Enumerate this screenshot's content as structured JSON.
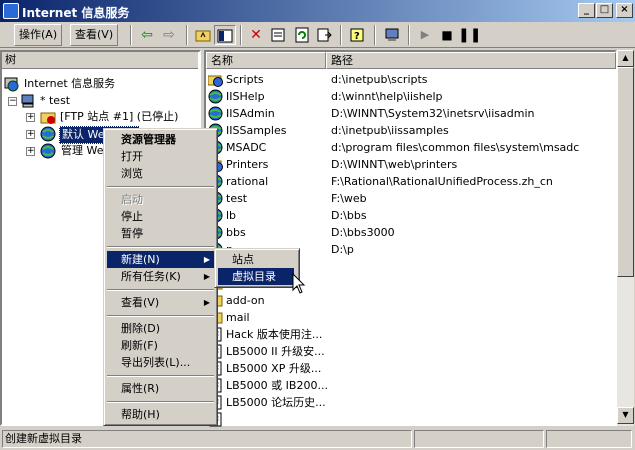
{
  "window": {
    "title": "Internet 信息服务"
  },
  "menubar": {
    "action": "操作(A)",
    "view": "查看(V)"
  },
  "tree": {
    "header": "树",
    "root": "Internet 信息服务",
    "server": "* test",
    "ftp": "[FTP 站点 #1] (已停止)",
    "default_web": "默认 Web 站点",
    "admin_web": "管理 Web 站点"
  },
  "list": {
    "col_name": "名称",
    "col_path": "路径",
    "rows": [
      {
        "name": "Scripts",
        "path": "d:\\inetpub\\scripts",
        "icon": "globe-folder-icon"
      },
      {
        "name": "IISHelp",
        "path": "d:\\winnt\\help\\iishelp",
        "icon": "globe-icon"
      },
      {
        "name": "IISAdmin",
        "path": "D:\\WINNT\\System32\\inetsrv\\iisadmin",
        "icon": "globe-icon"
      },
      {
        "name": "IISSamples",
        "path": "d:\\inetpub\\iissamples",
        "icon": "globe-icon"
      },
      {
        "name": "MSADC",
        "path": "d:\\program files\\common files\\system\\msadc",
        "icon": "globe-icon"
      },
      {
        "name": "Printers",
        "path": "D:\\WINNT\\web\\printers",
        "icon": "globe-folder-icon"
      },
      {
        "name": "rational",
        "path": "F:\\Rational\\RationalUnifiedProcess.zh_cn",
        "icon": "globe-icon"
      },
      {
        "name": "test",
        "path": "F:\\web",
        "icon": "globe-icon"
      },
      {
        "name": "lb",
        "path": "D:\\bbs",
        "icon": "globe-icon"
      },
      {
        "name": "bbs",
        "path": "D:\\bbs3000",
        "icon": "globe-icon"
      },
      {
        "name": "p",
        "path": "D:\\p",
        "icon": "globe-icon"
      },
      {
        "name": "",
        "path": "",
        "icon": "folder-icon"
      },
      {
        "name": "",
        "path": "",
        "icon": "folder-icon"
      },
      {
        "name": "add-on",
        "path": "",
        "icon": "folder-icon"
      },
      {
        "name": "mail",
        "path": "",
        "icon": "folder-icon"
      },
      {
        "name": "Hack 版本使用注...",
        "path": "",
        "icon": "file-icon"
      },
      {
        "name": "LB5000 II 升级安...",
        "path": "",
        "icon": "file-icon"
      },
      {
        "name": "LB5000 XP 升级...",
        "path": "",
        "icon": "file-icon"
      },
      {
        "name": "LB5000 或 IB200...",
        "path": "",
        "icon": "file-icon"
      },
      {
        "name": "LB5000 论坛历史...",
        "path": "",
        "icon": "file-icon"
      },
      {
        "name": "",
        "path": "",
        "icon": "file-icon"
      }
    ]
  },
  "context_menu": {
    "open_manager": "资源管理器",
    "open": "打开",
    "browse": "浏览",
    "start": "启动",
    "stop": "停止",
    "pause": "暂停",
    "new": "新建(N)",
    "all_tasks": "所有任务(K)",
    "view": "查看(V)",
    "delete": "删除(D)",
    "refresh": "刷新(F)",
    "export": "导出列表(L)...",
    "properties": "属性(R)",
    "help": "帮助(H)"
  },
  "submenu": {
    "site": "站点",
    "virtual_dir": "虚拟目录"
  },
  "status": {
    "text": "创建新虚拟目录"
  },
  "colors": {
    "title_start": "#0a246a",
    "title_end": "#a6caf0",
    "highlight": "#0a246a"
  }
}
